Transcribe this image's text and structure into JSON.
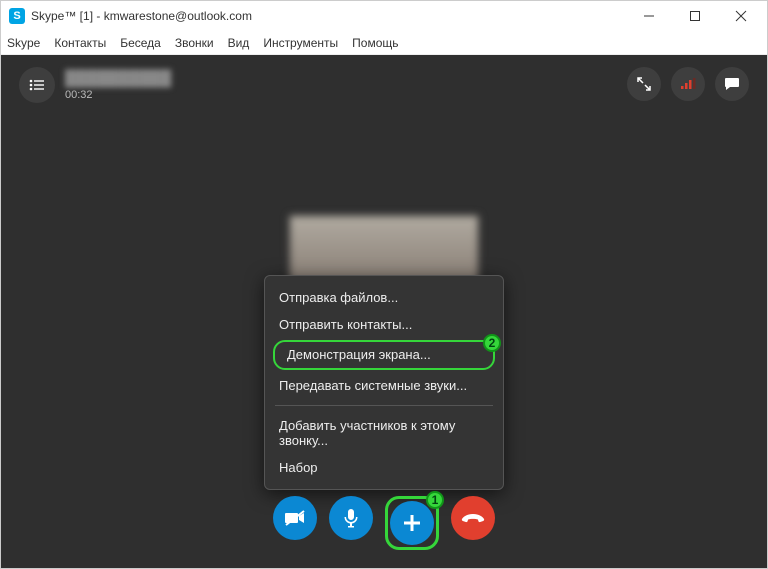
{
  "window": {
    "title": "Skype™ [1] - kmwarestone@outlook.com"
  },
  "menu": {
    "items": [
      "Skype",
      "Контакты",
      "Беседа",
      "Звонки",
      "Вид",
      "Инструменты",
      "Помощь"
    ]
  },
  "call": {
    "contact_name": "██████████",
    "duration": "00:32"
  },
  "popup": {
    "send_files": "Отправка файлов...",
    "send_contacts": "Отправить контакты...",
    "share_screen": "Демонстрация экрана...",
    "share_system_sounds": "Передавать системные звуки...",
    "add_people": "Добавить участников к этому звонку...",
    "dialpad": "Набор"
  },
  "badges": {
    "one": "1",
    "two": "2"
  },
  "icons": {
    "app": "S"
  }
}
